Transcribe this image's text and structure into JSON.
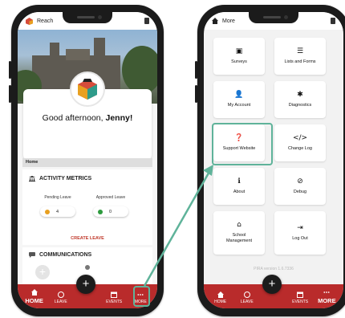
{
  "left_phone": {
    "app_title": "Reach",
    "greeting_prefix": "Good afternoon, ",
    "greeting_name": "Jenny!",
    "breadcrumb": "Home",
    "activity_title": "ACTIVITY METRICS",
    "metrics": [
      {
        "label": "Pending Leave",
        "value": "4",
        "color": "#e8a020"
      },
      {
        "label": "Approved Leave",
        "value": "0",
        "color": "#2e9b3e"
      }
    ],
    "create_leave": "CREATE LEAVE",
    "communications_title": "COMMUNICATIONS",
    "fab_label": "+",
    "nav": [
      {
        "label": "HOME",
        "icon": "home-icon"
      },
      {
        "label": "LEAVE",
        "icon": "leave-icon"
      },
      {
        "label": "EVENTS",
        "icon": "calendar-icon"
      },
      {
        "label": "MORE",
        "icon": "more-icon"
      }
    ]
  },
  "right_phone": {
    "title": "More",
    "tiles": [
      {
        "label": "Surveys",
        "icon": "surveys-icon",
        "glyph": "▣"
      },
      {
        "label": "Lists and Forms",
        "icon": "list-icon",
        "glyph": "☰"
      },
      {
        "label": "My Account",
        "icon": "person-icon",
        "glyph": "👤"
      },
      {
        "label": "Diagnostics",
        "icon": "bug-icon",
        "glyph": "✱"
      },
      {
        "label": "Support Website",
        "icon": "help-icon",
        "glyph": "❓"
      },
      {
        "label": "Change Log",
        "icon": "code-icon",
        "glyph": "</>"
      },
      {
        "label": "About",
        "icon": "info-icon",
        "glyph": "ℹ"
      },
      {
        "label": "Debug",
        "icon": "debug-icon",
        "glyph": "⊘"
      },
      {
        "label": "School Management",
        "icon": "school-icon",
        "glyph": "⌂"
      },
      {
        "label": "Log Out",
        "icon": "logout-icon",
        "glyph": "⇥"
      }
    ],
    "version": "PIRA version 1.6.7336",
    "fab_label": "+",
    "nav": [
      {
        "label": "HOME",
        "icon": "home-icon"
      },
      {
        "label": "LEAVE",
        "icon": "leave-icon"
      },
      {
        "label": "EVENTS",
        "icon": "calendar-icon"
      },
      {
        "label": "MORE",
        "icon": "more-icon"
      }
    ]
  },
  "colors": {
    "nav_red": "#b92b2b",
    "highlight_green": "#5fb39a",
    "fab_dark": "#1c1c1c"
  }
}
